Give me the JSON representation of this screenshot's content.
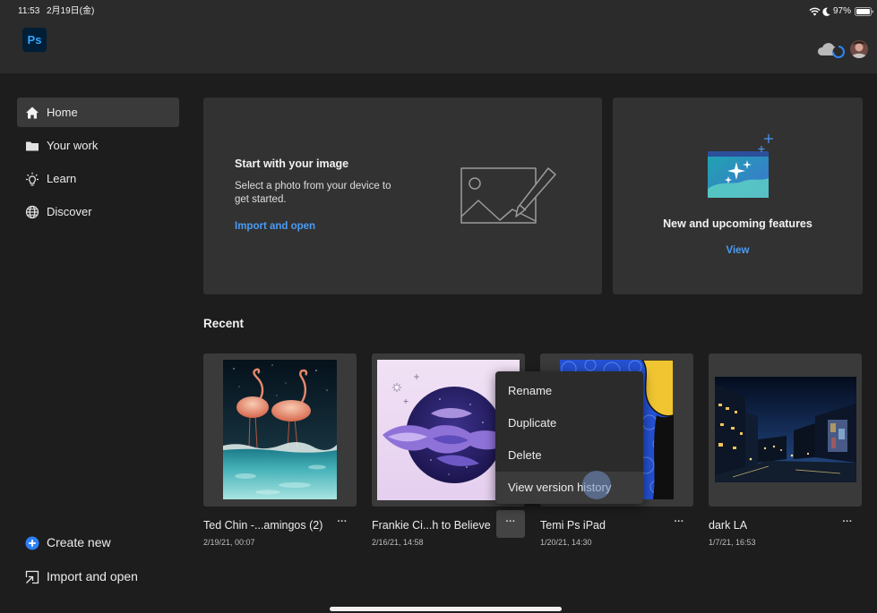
{
  "status_bar": {
    "time": "11:53",
    "date": "2月19日(金)",
    "battery": "97%"
  },
  "app": {
    "logo": "Ps"
  },
  "header": {
    "cloud_icon": "cloud-sync-icon",
    "avatar_icon": "avatar"
  },
  "sidebar": {
    "items": [
      {
        "label": "Home",
        "icon": "home-icon",
        "selected": true
      },
      {
        "label": "Your work",
        "icon": "folder-icon",
        "selected": false
      },
      {
        "label": "Learn",
        "icon": "lightbulb-icon",
        "selected": false
      },
      {
        "label": "Discover",
        "icon": "globe-icon",
        "selected": false
      }
    ],
    "actions": [
      {
        "label": "Create new",
        "icon": "plus-circle-icon"
      },
      {
        "label": "Import and open",
        "icon": "import-icon"
      }
    ]
  },
  "cards": {
    "start": {
      "title": "Start with your image",
      "description": "Select a photo from your device to get started.",
      "link": "Import and open"
    },
    "features": {
      "title": "New and upcoming features",
      "link": "View"
    }
  },
  "recent": {
    "heading": "Recent",
    "more_glyph": "···",
    "items": [
      {
        "name": "Ted Chin -...amingos (2)",
        "date": "2/19/21, 00:07",
        "menu_open": false
      },
      {
        "name": "Frankie Ci...h to Believe",
        "date": "2/16/21, 14:58",
        "menu_open": true
      },
      {
        "name": "Temi Ps iPad",
        "date": "1/20/21, 14:30",
        "menu_open": false
      },
      {
        "name": "dark LA",
        "date": "1/7/21, 16:53",
        "menu_open": false
      }
    ]
  },
  "context_menu": {
    "items": [
      {
        "label": "Rename",
        "highlighted": false
      },
      {
        "label": "Duplicate",
        "highlighted": false
      },
      {
        "label": "Delete",
        "highlighted": false
      },
      {
        "label": "View version history",
        "highlighted": true
      }
    ]
  },
  "colors": {
    "background": "#1d1d1d",
    "header": "#2b2b2b",
    "card": "#323232",
    "selected": "#3a3a3a",
    "accent": "#4b9cf5",
    "logo_bg": "#001e36",
    "logo_text": "#31a8ff"
  }
}
